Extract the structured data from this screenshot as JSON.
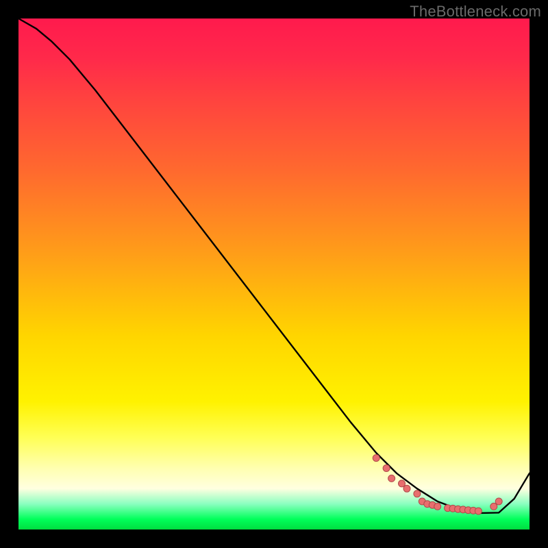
{
  "watermark": "TheBottleneck.com",
  "chart_data": {
    "type": "line",
    "title": "",
    "xlabel": "",
    "ylabel": "",
    "xlim": [
      0,
      100
    ],
    "ylim": [
      0,
      100
    ],
    "grid": false,
    "legend": false,
    "note": "Chart has no visible axis tick labels; values are normalized 0–100 estimates read from geometry.",
    "gradient_bands": [
      {
        "stop": 0,
        "color": "#ff1a4d"
      },
      {
        "stop": 8,
        "color": "#ff2a4a"
      },
      {
        "stop": 15,
        "color": "#ff4040"
      },
      {
        "stop": 30,
        "color": "#ff6a2e"
      },
      {
        "stop": 45,
        "color": "#ff9a1a"
      },
      {
        "stop": 62,
        "color": "#ffd500"
      },
      {
        "stop": 75,
        "color": "#fff200"
      },
      {
        "stop": 82,
        "color": "#ffff55"
      },
      {
        "stop": 88,
        "color": "#ffffb0"
      },
      {
        "stop": 92,
        "color": "#ffffe0"
      },
      {
        "stop": 95,
        "color": "#8affc0"
      },
      {
        "stop": 98,
        "color": "#00ff5a"
      },
      {
        "stop": 100,
        "color": "#00dd40"
      }
    ],
    "series": [
      {
        "name": "curve",
        "style": "line-black",
        "x": [
          0,
          3.5,
          6.5,
          10,
          15,
          20,
          25,
          30,
          35,
          40,
          45,
          50,
          55,
          60,
          65,
          70,
          74,
          78,
          82,
          86,
          90,
          94,
          97,
          100
        ],
        "y": [
          100,
          98,
          95.5,
          92,
          86,
          79.5,
          73,
          66.5,
          60,
          53.5,
          47,
          40.5,
          34,
          27.5,
          21,
          15,
          11,
          8,
          5.5,
          4,
          3.2,
          3.3,
          6,
          11
        ]
      },
      {
        "name": "markers",
        "style": "dots-salmon",
        "x": [
          70,
          72,
          73,
          75,
          76,
          78,
          79,
          80,
          81,
          82,
          84,
          85,
          86,
          87,
          88,
          89,
          90,
          93,
          94
        ],
        "y": [
          14,
          12,
          10,
          9,
          8,
          7,
          5.5,
          5,
          4.8,
          4.5,
          4.2,
          4.1,
          4,
          3.9,
          3.8,
          3.7,
          3.6,
          4.5,
          5.5
        ]
      }
    ]
  }
}
